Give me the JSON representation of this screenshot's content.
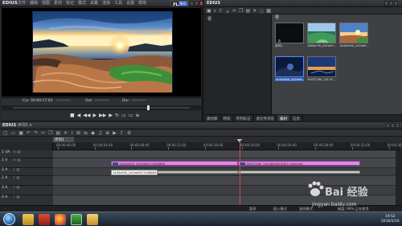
{
  "player": {
    "brand": "EDIUS",
    "menu": [
      "文件",
      "编辑",
      "视图",
      "素材",
      "标记",
      "模式",
      "采集",
      "渲染",
      "工具",
      "设置",
      "帮助"
    ],
    "mode_label": "PLR",
    "rec_label": "REC",
    "timecode": {
      "cur_label": "Cur",
      "cur_value": "00:00:17:03",
      "in_label": "In",
      "in_value": "--:--:--:--",
      "out_label": "Out",
      "out_value": "--:--:--:--",
      "dur_label": "Dur",
      "dur_value": "--:--:--:--"
    },
    "scrub_position": 0.76,
    "transport_icons": [
      "stop-icon",
      "prev-frame-icon",
      "rewind-icon",
      "play-icon",
      "fast-forward-icon",
      "next-frame-icon",
      "loop-icon",
      "insert-icon",
      "overwrite-icon",
      "output-icon"
    ],
    "transport_glyphs": [
      "■",
      "◀",
      "◀◀",
      "▶",
      "▶▶",
      "▶",
      "↻",
      "▭",
      "▭",
      "≡"
    ]
  },
  "bin": {
    "title": "EDIUS",
    "tree_root": "根",
    "crumb": "根",
    "clips": [
      {
        "name": "序列1",
        "kind": "sequence"
      },
      {
        "name": "1660e7f0_2d7ed9...",
        "kind": "green"
      },
      {
        "name": "1440x900_2d7ed9...",
        "kind": "coast"
      },
      {
        "name": "1440x900_2d7ed9...",
        "kind": "rock"
      },
      {
        "name": "39037284_14119...",
        "kind": "dusk"
      }
    ],
    "tabs": [
      "素材库",
      "特效",
      "序列标记",
      "源文件浏览",
      "素材",
      "信息"
    ],
    "active_tab": 4
  },
  "timeline": {
    "brand": "EDIUS",
    "sequence_label": "序列1 ▾",
    "seq_tab": "序列1",
    "ruler": [
      "00:00:00:00",
      "00:00:04:00",
      "00:00:08:00",
      "00:00:12:00",
      "00:00:16:00",
      "00:00:20:00",
      "00:00:24:00",
      "00:00:28:00",
      "00:00:32:00",
      "00:00:36:00"
    ],
    "tracks": [
      {
        "label": "1 VA",
        "icons": "⊙ ▤"
      },
      {
        "label": "1 V",
        "icons": "⊙ ▤"
      },
      {
        "label": "1 A",
        "icons": "♪ ▤"
      },
      {
        "label": "2 A",
        "icons": "♪ ▤"
      },
      {
        "label": "3 A",
        "icons": "♪ ▤"
      },
      {
        "label": "4 A",
        "icons": "♪ ▤"
      }
    ],
    "clip1": "1440x900_2d7ed9917d28889",
    "clip2": "39037284_1411854415923_mthumb",
    "tooltip": "1440x900_2d7ed9917d28889"
  },
  "status": {
    "left": "暂停",
    "insert": "插入模式",
    "ripple": "波纹模式",
    "disk": "磁盘: 99% 正在使用"
  },
  "taskbar": {
    "apps": [
      "explorer",
      "media",
      "firefox",
      "edius",
      "folder"
    ],
    "time": "19:52",
    "date": "2016/5/10"
  },
  "watermark": {
    "text": "Bai 经验",
    "url": "jingyan.baidu.com"
  },
  "colors": {
    "clip_video": "#e08be0",
    "playhead": "#e04040",
    "selection": "#2f6ad0"
  }
}
